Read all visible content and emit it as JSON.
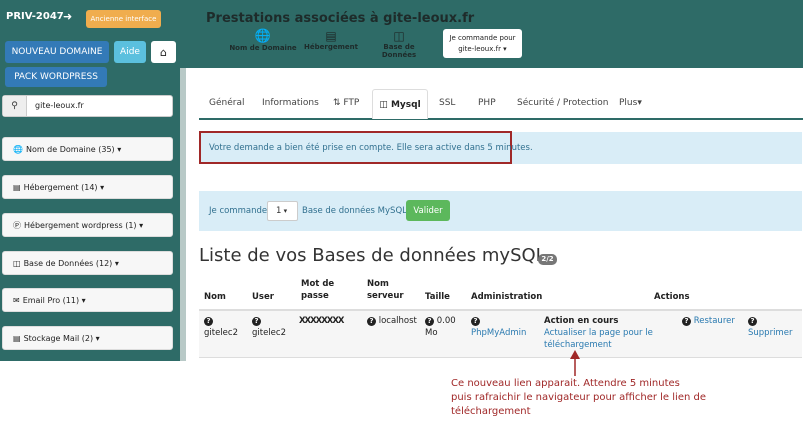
{
  "header": {
    "account": "PRIV-2047",
    "legacy_label": "Ancienne interface",
    "title": "Prestations associées à gite-leoux.fr",
    "nav": [
      {
        "label": "Nom de Domaine"
      },
      {
        "label": "Hébergement"
      },
      {
        "label": "Base de Données"
      }
    ],
    "order_line1": "Je commande pour",
    "order_line2": "gite-leoux.fr"
  },
  "sidebar": {
    "new_domain": "NOUVEAU DOMAINE",
    "help": "Aide",
    "pack": "PACK WORDPRESS",
    "search_value": "gite-leoux.fr",
    "items": [
      {
        "label": "Nom de Domaine (35)"
      },
      {
        "label": "Hébergement (14)"
      },
      {
        "label": "Hébergement wordpress (1)"
      },
      {
        "label": "Base de Données (12)"
      },
      {
        "label": "Email Pro (11)"
      },
      {
        "label": "Stockage Mail (2)"
      }
    ]
  },
  "tabs": [
    {
      "label": "Général"
    },
    {
      "label": "Informations"
    },
    {
      "label": "FTP"
    },
    {
      "label": "Mysql"
    },
    {
      "label": "SSL"
    },
    {
      "label": "PHP"
    },
    {
      "label": "Sécurité / Protection"
    },
    {
      "label": "Plus"
    }
  ],
  "notice": "Votre demande a bien été prise en compte. Elle sera active dans 5 minutes.",
  "order": {
    "prefix": "Je commande",
    "qty": "1",
    "suffix": "Base de données MySQL",
    "submit": "Valider"
  },
  "section": {
    "title": "Liste de vos Bases de données mySQL",
    "badge": "2/2"
  },
  "table": {
    "headers": {
      "nom": "Nom",
      "user": "User",
      "pass1": "Mot de",
      "pass2": "passe",
      "serv1": "Nom",
      "serv2": "serveur",
      "size": "Taille",
      "admin": "Administration",
      "actions": "Actions"
    },
    "row": {
      "nom": "gitelec2",
      "user": "gitelec2",
      "pass": "XXXXXXXX",
      "server": "localhost",
      "size1": "0.00",
      "size2": "Mo",
      "admin_link": "PhpMyAdmin",
      "status": "Action en cours",
      "refresh1": "Actualiser la page pour le",
      "refresh2": "téléchargement",
      "restore": "Restaurer",
      "delete": "Supprimer"
    }
  },
  "annotation": {
    "line1": "Ce nouveau lien apparait. Attendre 5 minutes",
    "line2": "puis rafraichir le navigateur pour afficher le lien de",
    "line3": "téléchargement"
  }
}
